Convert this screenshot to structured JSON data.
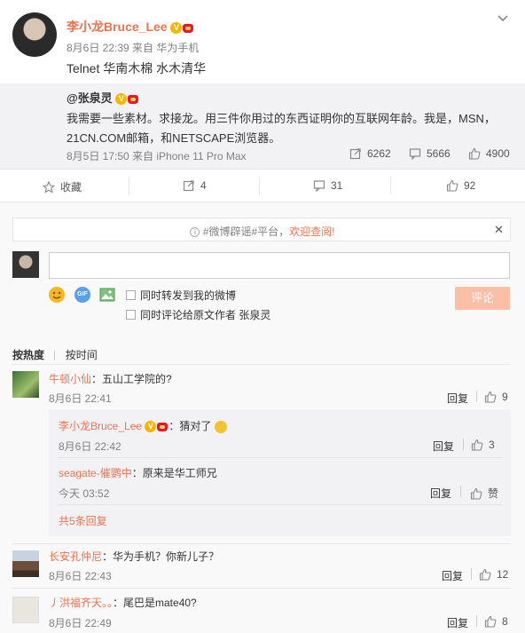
{
  "post": {
    "author": "李小龙Bruce_Lee",
    "meta": "8月6日 22:39 来自 华为手机",
    "text": "Telnet 华南木棉 水木清华",
    "more_icon": "chevron-down-icon"
  },
  "repost": {
    "author": "@张泉灵",
    "text_line1": "我需要一些素材。求接龙。用三件你用过的东西证明你的互联网年龄。我是，MSN，",
    "text_line2": "21CN.COM邮箱，和NETSCAPE浏览器。",
    "meta": "8月5日 17:50 来自 iPhone 11 Pro Max",
    "forward_count": "6262",
    "comment_count": "5666",
    "like_count": "4900"
  },
  "actions": {
    "favorite_label": "收藏",
    "forward_count": "4",
    "comment_count": "31",
    "like_count": "92"
  },
  "notice": {
    "text_prefix": "#微博辟谣#平台，",
    "text_link": "欢迎查阅!"
  },
  "composer": {
    "input_value": "",
    "check1_label": "同时转发到我的微博",
    "check2_label": "同时评论给原文作者 张泉灵",
    "submit_label": "评论",
    "gif_label": "GIF"
  },
  "sort": {
    "hot": "按热度",
    "time": "按时间"
  },
  "comments": [
    {
      "user": "牛顿小仙",
      "text": "：五山工学院的?",
      "time": "8月6日 22:41",
      "reply": "回复",
      "likes": "9"
    },
    {
      "user": "长安孔仲尼",
      "text": "：华为手机？你新儿子？",
      "time": "8月6日 22:43",
      "reply": "回复",
      "likes": "12"
    },
    {
      "user": "丿洪福齐天。。",
      "text": "：尾巴是mate40?",
      "time": "8月6日 22:49",
      "reply": "回复",
      "likes": "8"
    }
  ],
  "replies": [
    {
      "user": "李小龙Bruce_Lee",
      "text": "：猜对了",
      "time": "8月6日 22:42",
      "reply": "回复",
      "likes": "3"
    },
    {
      "user": "seagate-催鹦中",
      "text": "：原来是华工师兄",
      "time": "今天 03:52",
      "reply": "回复",
      "likes": "赞"
    }
  ],
  "replies_more": "共5条回复",
  "colors": {
    "accent": "#eb7350",
    "link": "#eb7350",
    "button_disabled": "#fbbfa6"
  }
}
